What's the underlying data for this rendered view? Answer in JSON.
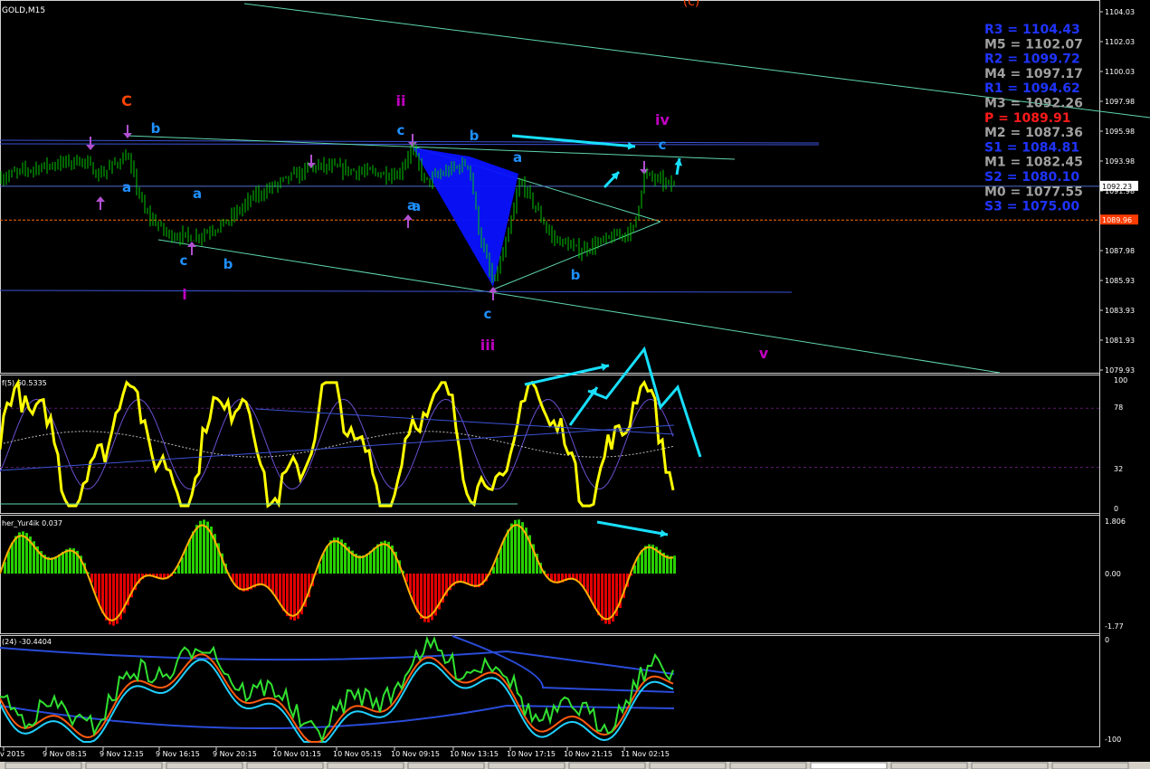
{
  "window": {
    "symbol_label": "GOLD,M15",
    "top_red_label": "(c)"
  },
  "colors": {
    "background": "#000000",
    "frame": "#ffffff",
    "price": "#00c800",
    "channel": "#5fd6b0",
    "hline": "#3c52d6",
    "pivot_line": "#ff6a00",
    "wave_blue": "#1e90ff",
    "wave_magenta": "#c000c0",
    "wave_red": "#ff4500",
    "arrow_cyan": "#18e0ff",
    "yellow": "#ffff00",
    "fisher_green": "#28d000",
    "fisher_red": "#e00000",
    "level_blue": "#1f34ff",
    "level_gray": "#a0a0a0",
    "level_red": "#ff1a1a"
  },
  "pivots": [
    {
      "text": "R3 = 1104.43",
      "kind": "R"
    },
    {
      "text": "M5 = 1102.07",
      "kind": "M"
    },
    {
      "text": "R2 = 1099.72",
      "kind": "R"
    },
    {
      "text": "M4 = 1097.17",
      "kind": "M"
    },
    {
      "text": "R1 = 1094.62",
      "kind": "R"
    },
    {
      "text": "M3 = 1092.26",
      "kind": "M"
    },
    {
      "text": "P    = 1089.91",
      "kind": "P"
    },
    {
      "text": "M2 = 1087.36",
      "kind": "M"
    },
    {
      "text": "S1 = 1084.81",
      "kind": "R"
    },
    {
      "text": "M1 = 1082.45",
      "kind": "M"
    },
    {
      "text": "S2 = 1080.10",
      "kind": "R"
    },
    {
      "text": "M0 = 1077.55",
      "kind": "M"
    },
    {
      "text": "S3 = 1075.00",
      "kind": "R"
    }
  ],
  "price_axis": {
    "ticks": [
      "1104.03",
      "1102.03",
      "1100.03",
      "1097.98",
      "1095.98",
      "1093.98",
      "1091.98",
      "1089.98",
      "1087.98",
      "1085.93",
      "1083.93",
      "1081.93",
      "1079.93"
    ],
    "current_price": "1092.23",
    "pivot_price": "1089.96"
  },
  "wave_labels": [
    {
      "t": "C",
      "color": "red"
    },
    {
      "t": "ii",
      "color": "magenta"
    },
    {
      "t": "iv",
      "color": "magenta"
    },
    {
      "t": "i",
      "color": "magenta"
    },
    {
      "t": "iii",
      "color": "magenta"
    },
    {
      "t": "v",
      "color": "magenta"
    },
    {
      "t": "b",
      "color": "blue"
    },
    {
      "t": "a",
      "color": "blue"
    },
    {
      "t": "c",
      "color": "blue"
    },
    {
      "t": "b",
      "color": "blue"
    },
    {
      "t": "c",
      "color": "blue"
    },
    {
      "t": "a",
      "color": "blue"
    },
    {
      "t": "b",
      "color": "blue"
    },
    {
      "t": "a",
      "color": "blue"
    },
    {
      "t": "c",
      "color": "blue"
    },
    {
      "t": "b",
      "color": "blue"
    },
    {
      "t": "c",
      "color": "blue"
    },
    {
      "t": "a",
      "color": "blue"
    },
    {
      "t": "a",
      "color": "blue"
    }
  ],
  "indicators": {
    "osc1": {
      "label": "f(5) 60.5335",
      "ticks": [
        "100",
        "78",
        "32",
        "0"
      ]
    },
    "fisher": {
      "label": "her_Yur4ik 0.037",
      "ticks": [
        "1.806",
        "0.00",
        "-1.77"
      ]
    },
    "wpr": {
      "label": "(24) -30.4404",
      "ticks": [
        "0",
        "-100"
      ]
    }
  },
  "time_axis": [
    "v 2015",
    "9 Nov 08:15",
    "9 Nov 12:15",
    "9 Nov 16:15",
    "9 Nov 20:15",
    "10 Nov 01:15",
    "10 Nov 05:15",
    "10 Nov 09:15",
    "10 Nov 13:15",
    "10 Nov 17:15",
    "10 Nov 21:15",
    "11 Nov 02:15"
  ],
  "chart_data": {
    "type": "line",
    "title": "GOLD,M15",
    "x": [
      "v 2015",
      "9 Nov 08:15",
      "9 Nov 12:15",
      "9 Nov 16:15",
      "9 Nov 20:15",
      "10 Nov 01:15",
      "10 Nov 05:15",
      "10 Nov 09:15",
      "10 Nov 13:15",
      "10 Nov 17:15",
      "10 Nov 21:15",
      "11 Nov 02:15"
    ],
    "series": [
      {
        "name": "",
        "values": [
          1092.8,
          1093.8,
          1094.3,
          1088.8,
          1090.6,
          1093.5,
          1093.1,
          1092.2,
          1085.6,
          1089.4,
          1088.1,
          1092.2
        ]
      }
    ],
    "ylim": [
      1079.5,
      1104.9
    ],
    "grid": false
  }
}
